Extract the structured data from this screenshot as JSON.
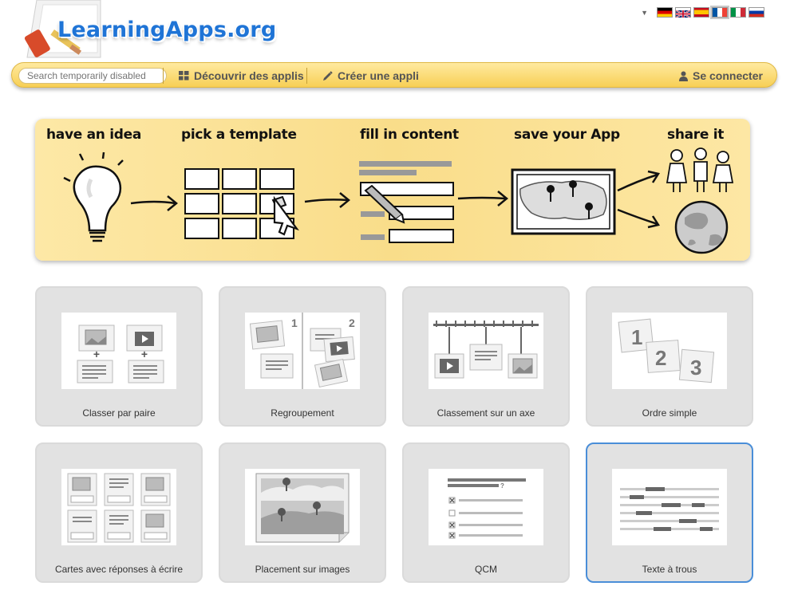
{
  "header": {
    "logo_text": "LearningApps.org"
  },
  "languages": [
    {
      "code": "de",
      "icon": "flag-germany-icon"
    },
    {
      "code": "en",
      "icon": "flag-uk-icon"
    },
    {
      "code": "es",
      "icon": "flag-spain-icon"
    },
    {
      "code": "fr",
      "icon": "flag-france-icon",
      "active": true
    },
    {
      "code": "it",
      "icon": "flag-italy-icon"
    },
    {
      "code": "ru",
      "icon": "flag-russia-icon"
    }
  ],
  "navbar": {
    "search_placeholder": "Search temporarily disabled",
    "discover_label": "Découvrir des applis",
    "create_label": "Créer une appli",
    "login_label": "Se connecter"
  },
  "banner": {
    "steps": [
      "have an idea",
      "pick a template",
      "fill in content",
      "save your App",
      "share it"
    ]
  },
  "templates": [
    {
      "label": "Classer par paire"
    },
    {
      "label": "Regroupement"
    },
    {
      "label": "Classement sur un axe"
    },
    {
      "label": "Ordre simple"
    },
    {
      "label": "Cartes avec réponses à écrire"
    },
    {
      "label": "Placement sur images"
    },
    {
      "label": "QCM"
    },
    {
      "label": "Texte à trous"
    }
  ],
  "thumbs": {
    "group_numbers": [
      "1",
      "2"
    ],
    "order_numbers": [
      "1",
      "2",
      "3"
    ],
    "qcm_question_mark": "?"
  },
  "colors": {
    "logo_blue": "#1f74d6",
    "navbar_yellow": "#f7cf55",
    "banner_yellow": "#f9dd8a",
    "tile_gray": "#e2e2e2",
    "selected_border": "#4a8ed8"
  }
}
